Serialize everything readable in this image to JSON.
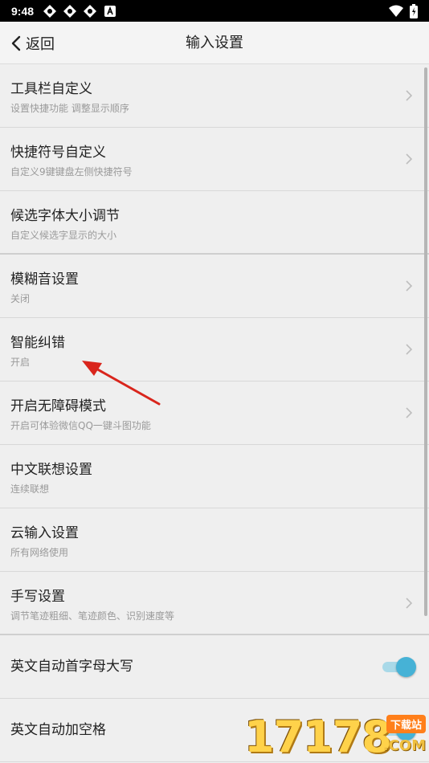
{
  "status_bar": {
    "time": "9:48",
    "icons": [
      "gear-icon",
      "gear-icon",
      "gear-icon",
      "a-icon"
    ],
    "right_icons": [
      "wifi-icon",
      "battery-icon"
    ]
  },
  "header": {
    "back_label": "返回",
    "title": "输入设置"
  },
  "items": [
    {
      "title": "工具栏自定义",
      "subtitle": "设置快捷功能 调整显示顺序",
      "has_chevron": true
    },
    {
      "title": "快捷符号自定义",
      "subtitle": "自定义9键键盘左侧快捷符号",
      "has_chevron": true
    },
    {
      "title": "候选字体大小调节",
      "subtitle": "自定义候选字显示的大小",
      "has_chevron": false
    },
    {
      "title": "模糊音设置",
      "subtitle": "关闭",
      "has_chevron": true
    },
    {
      "title": "智能纠错",
      "subtitle": "开启",
      "has_chevron": true
    },
    {
      "title": "开启无障碍模式",
      "subtitle": "开启可体验微信QQ一键斗图功能",
      "has_chevron": true
    },
    {
      "title": "中文联想设置",
      "subtitle": "连续联想",
      "has_chevron": false
    },
    {
      "title": "云输入设置",
      "subtitle": "所有网络使用",
      "has_chevron": false
    },
    {
      "title": "手写设置",
      "subtitle": "调节笔迹粗细、笔迹颜色、识别速度等",
      "has_chevron": true
    },
    {
      "title": "英文自动首字母大写",
      "toggle": "on"
    },
    {
      "title": "英文自动加空格",
      "toggle": "on"
    }
  ],
  "colors": {
    "toggle_on": "#46b2d6",
    "annotation_arrow": "#d9251c"
  },
  "watermark": {
    "digits": "17178",
    "tag": "下载站",
    "domain": ".COM"
  }
}
